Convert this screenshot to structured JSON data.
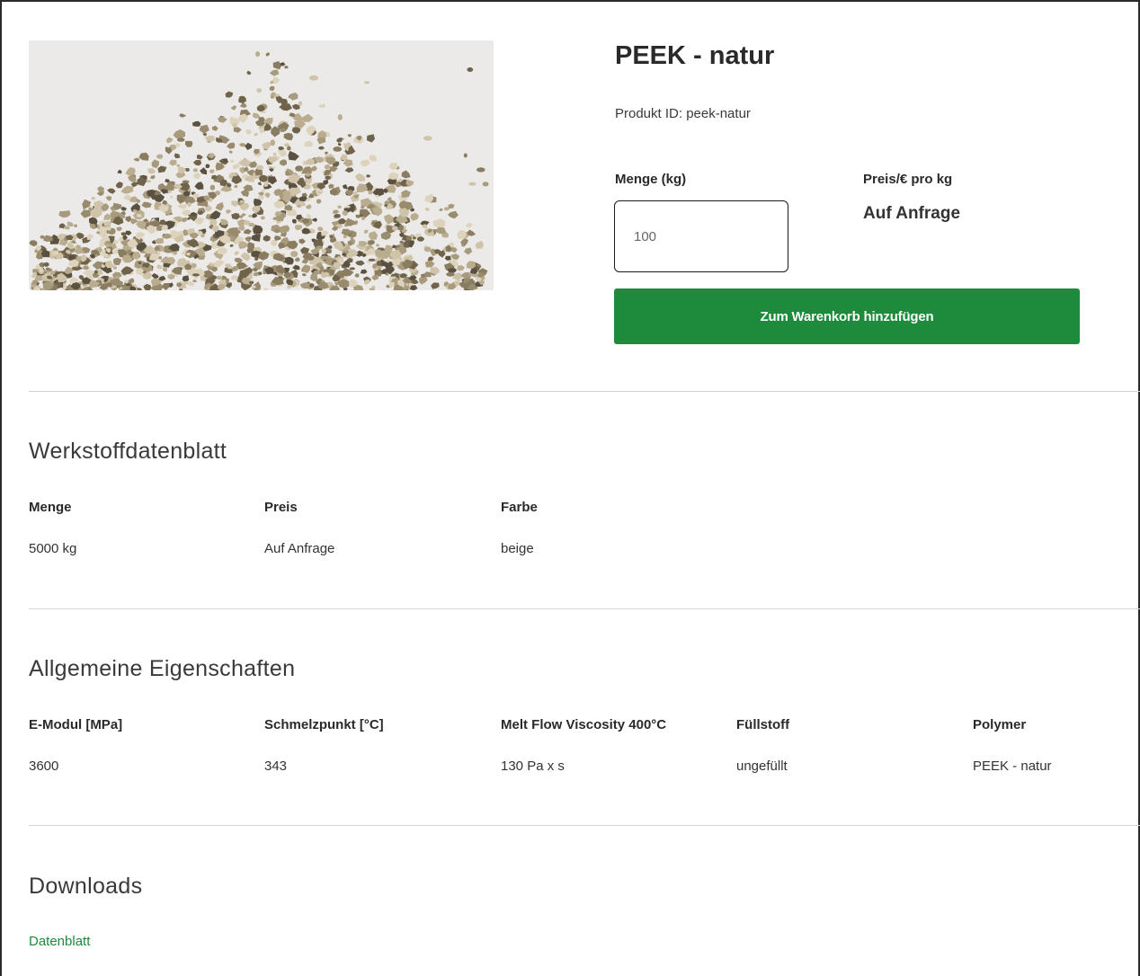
{
  "product": {
    "title": "PEEK - natur",
    "id_text": "Produkt ID: peek-natur",
    "image_alt": "PEEK natur Granulat"
  },
  "order": {
    "quantity_label": "Menge (kg)",
    "quantity_placeholder": "100",
    "price_label": "Preis/€ pro kg",
    "price_value": "Auf Anfrage",
    "add_to_cart_label": "Zum Warenkorb hinzufügen"
  },
  "datasheet": {
    "heading": "Werkstoffdatenblatt",
    "columns": [
      {
        "header": "Menge",
        "value": "5000 kg"
      },
      {
        "header": "Preis",
        "value": "Auf Anfrage"
      },
      {
        "header": "Farbe",
        "value": "beige"
      }
    ]
  },
  "properties": {
    "heading": "Allgemeine Eigenschaften",
    "columns": [
      {
        "header": "E-Modul [MPa]",
        "value": "3600"
      },
      {
        "header": "Schmelzpunkt [°C]",
        "value": "343"
      },
      {
        "header": "Melt Flow Viscosity 400°C",
        "value": "130 Pa x s"
      },
      {
        "header": "Füllstoff",
        "value": "ungefüllt"
      },
      {
        "header": "Polymer",
        "value": "PEEK - natur"
      }
    ]
  },
  "downloads": {
    "heading": "Downloads",
    "links": [
      {
        "label": "Datenblatt"
      }
    ]
  },
  "colors": {
    "accent_green": "#1e8a3b",
    "text_dark": "#2a2a2a",
    "divider": "#d6d6d6",
    "granulate": "#9f9174"
  }
}
